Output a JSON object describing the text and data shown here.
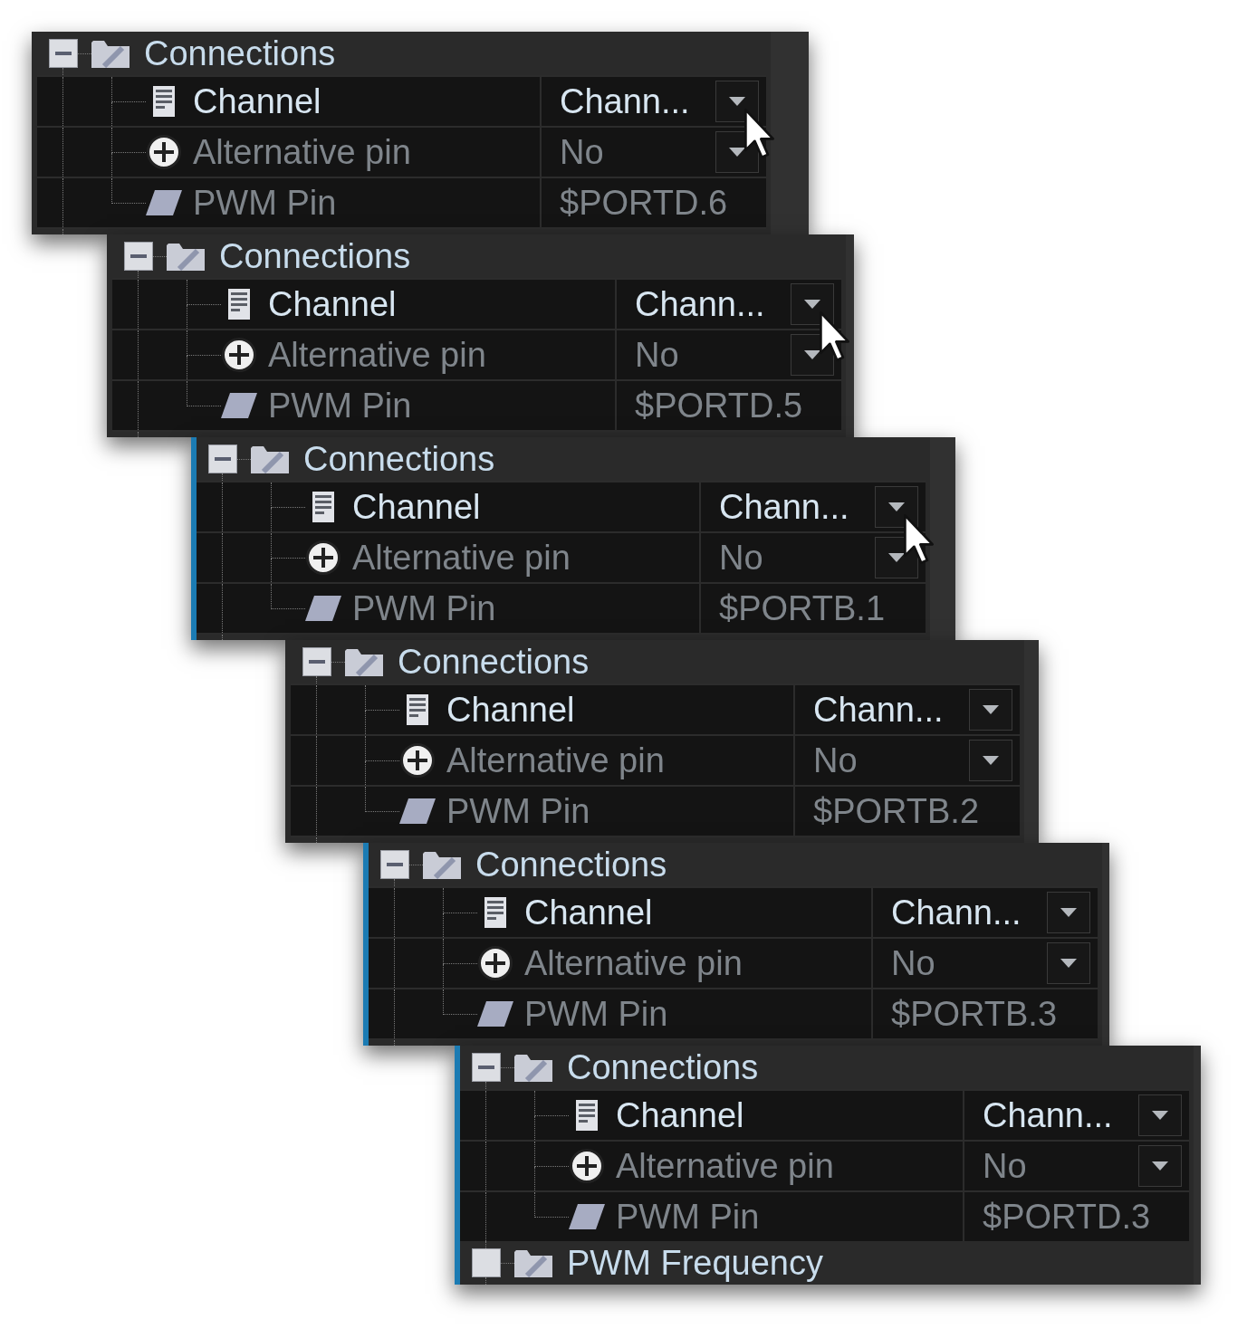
{
  "panels": [
    {
      "highlighted": false,
      "cursor_visible": true,
      "groups": [
        {
          "label": "Connections",
          "expanded": true,
          "properties": [
            {
              "name": "Channel",
              "kind": "dropdown",
              "disabled": false,
              "value": "Chann..."
            },
            {
              "name": "Alternative pin",
              "kind": "dropdown",
              "disabled": true,
              "value": "No"
            },
            {
              "name": "PWM Pin",
              "kind": "text",
              "disabled": true,
              "value": "$PORTD.6"
            }
          ]
        }
      ]
    },
    {
      "highlighted": false,
      "cursor_visible": true,
      "groups": [
        {
          "label": "Connections",
          "expanded": true,
          "properties": [
            {
              "name": "Channel",
              "kind": "dropdown",
              "disabled": false,
              "value": "Chann..."
            },
            {
              "name": "Alternative pin",
              "kind": "dropdown",
              "disabled": true,
              "value": "No"
            },
            {
              "name": "PWM Pin",
              "kind": "text",
              "disabled": true,
              "value": "$PORTD.5"
            }
          ]
        }
      ]
    },
    {
      "highlighted": true,
      "cursor_visible": true,
      "groups": [
        {
          "label": "Connections",
          "expanded": true,
          "properties": [
            {
              "name": "Channel",
              "kind": "dropdown",
              "disabled": false,
              "value": "Chann..."
            },
            {
              "name": "Alternative pin",
              "kind": "dropdown",
              "disabled": true,
              "value": "No"
            },
            {
              "name": "PWM Pin",
              "kind": "text",
              "disabled": true,
              "value": "$PORTB.1"
            }
          ]
        }
      ]
    },
    {
      "highlighted": false,
      "cursor_visible": false,
      "groups": [
        {
          "label": "Connections",
          "expanded": true,
          "properties": [
            {
              "name": "Channel",
              "kind": "dropdown",
              "disabled": false,
              "value": "Chann..."
            },
            {
              "name": "Alternative pin",
              "kind": "dropdown",
              "disabled": true,
              "value": "No"
            },
            {
              "name": "PWM Pin",
              "kind": "text",
              "disabled": true,
              "value": "$PORTB.2"
            }
          ]
        }
      ]
    },
    {
      "highlighted": true,
      "cursor_visible": false,
      "groups": [
        {
          "label": "Connections",
          "expanded": true,
          "properties": [
            {
              "name": "Channel",
              "kind": "dropdown",
              "disabled": false,
              "value": "Chann..."
            },
            {
              "name": "Alternative pin",
              "kind": "dropdown",
              "disabled": true,
              "value": "No"
            },
            {
              "name": "PWM Pin",
              "kind": "text",
              "disabled": true,
              "value": "$PORTB.3"
            }
          ]
        }
      ]
    },
    {
      "highlighted": true,
      "cursor_visible": false,
      "groups": [
        {
          "label": "Connections",
          "expanded": true,
          "properties": [
            {
              "name": "Channel",
              "kind": "dropdown",
              "disabled": false,
              "value": "Chann..."
            },
            {
              "name": "Alternative pin",
              "kind": "dropdown",
              "disabled": true,
              "value": "No"
            },
            {
              "name": "PWM Pin",
              "kind": "text",
              "disabled": true,
              "value": "$PORTD.3"
            }
          ]
        },
        {
          "label": "PWM Frequency"
        }
      ]
    }
  ]
}
